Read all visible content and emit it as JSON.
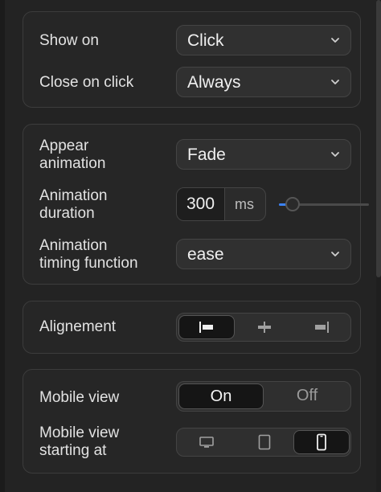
{
  "panel1": {
    "show_on": {
      "label": "Show on",
      "value": "Click"
    },
    "close_on_click": {
      "label": "Close on click",
      "value": "Always"
    }
  },
  "panel2": {
    "appear_animation": {
      "label_line1": "Appear",
      "label_line2": "animation",
      "value": "Fade"
    },
    "animation_duration": {
      "label_line1": "Animation",
      "label_line2": "duration",
      "value": "300",
      "unit": "ms",
      "slider_fraction": 0.08
    },
    "timing_function": {
      "label_line1": "Animation",
      "label_line2": "timing function",
      "value": "ease"
    }
  },
  "panel3": {
    "alignment": {
      "label": "Alignement",
      "options": [
        "left-align-icon",
        "center-align-icon",
        "right-align-icon"
      ],
      "selected": "left"
    }
  },
  "panel4": {
    "mobile_view": {
      "label": "Mobile view",
      "on": "On",
      "off": "Off",
      "selected": "On"
    },
    "mobile_view_starting_at": {
      "label_line1": "Mobile view",
      "label_line2": "starting at",
      "options": [
        "desktop-icon",
        "tablet-icon",
        "mobile-icon"
      ],
      "selected": "mobile"
    }
  },
  "colors": {
    "accent": "#3b82f6",
    "background": "#232323",
    "panel": "#262626"
  }
}
